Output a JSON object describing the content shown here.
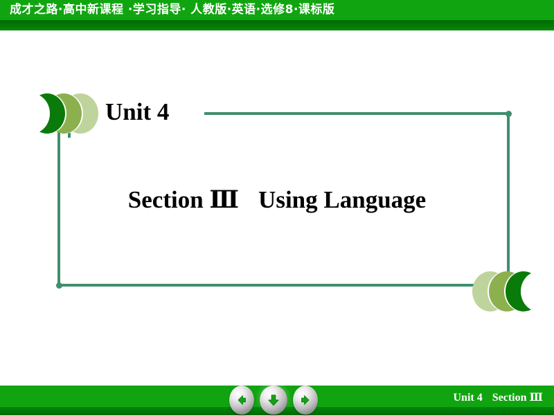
{
  "header": {
    "title": "成才之路·高中新课程 ·学习指导· 人教版·英语·选修8·课标版",
    "bar_color": "#10a510",
    "shadow_color": "#006b00"
  },
  "slide": {
    "unit_label": "Unit 4",
    "section_label": "Section Ⅲ",
    "section_topic": "Using Language",
    "frame_color": "#3f8f6e"
  },
  "decorations": {
    "left_chevrons": [
      {
        "name": "chevron-left-dark",
        "color": "#0a7a0a"
      },
      {
        "name": "chevron-left-medium",
        "color": "#8db04f"
      },
      {
        "name": "chevron-left-light",
        "color": "#bed49c"
      }
    ],
    "right_chevrons": [
      {
        "name": "chevron-right-light",
        "color": "#bed49c"
      },
      {
        "name": "chevron-right-medium",
        "color": "#8db04f"
      },
      {
        "name": "chevron-right-dark",
        "color": "#0a7a0a"
      }
    ]
  },
  "footer": {
    "unit_label": "Unit 4",
    "section_label": "Section Ⅲ",
    "bar_color": "#10a510",
    "nav": [
      {
        "name": "previous-slide-button",
        "icon": "arrow-left-icon",
        "label": "Previous"
      },
      {
        "name": "down-slide-button",
        "icon": "arrow-down-icon",
        "label": "Down"
      },
      {
        "name": "next-slide-button",
        "icon": "arrow-right-icon",
        "label": "Next"
      }
    ]
  }
}
